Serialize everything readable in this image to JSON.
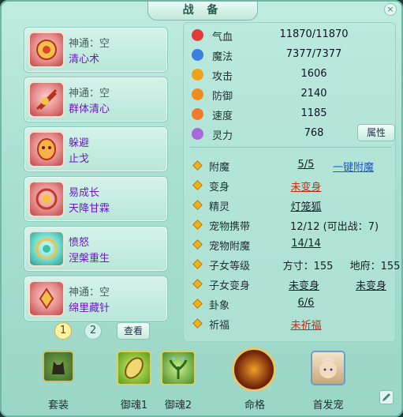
{
  "title": "战 备",
  "close_glyph": "×",
  "skills": [
    {
      "line1": "神通：空",
      "line2": "清心术",
      "icon": "skill-purify-icon"
    },
    {
      "line1": "神通：空",
      "line2": "群体清心",
      "icon": "skill-group-purify-icon"
    },
    {
      "line1": "躲避",
      "line2": "止戈",
      "icon": "skill-dodge-icon"
    },
    {
      "line1": "易成长",
      "line2": "天降甘霖",
      "icon": "skill-growth-icon"
    },
    {
      "line1": "愤怒",
      "line2": "涅槃重生",
      "icon": "skill-rage-icon"
    },
    {
      "line1": "神通：空",
      "line2": "绵里藏针",
      "icon": "skill-needle-icon"
    }
  ],
  "pager": {
    "page1": "1",
    "page2": "2",
    "view": "查看"
  },
  "stats": [
    {
      "label": "气血",
      "value": "11870/11870",
      "color": "#e23b3b"
    },
    {
      "label": "魔法",
      "value": "7377/7377",
      "color": "#3b7fe0"
    },
    {
      "label": "攻击",
      "value": "1606",
      "color": "#f0a11b"
    },
    {
      "label": "防御",
      "value": "2140",
      "color": "#f08c1b"
    },
    {
      "label": "速度",
      "value": "1185",
      "color": "#f27a2a"
    },
    {
      "label": "灵力",
      "value": "768",
      "color": "#a86ad8"
    }
  ],
  "attr_button": "属性",
  "details": {
    "enchant": {
      "label": "附魔",
      "value": "5/5",
      "link": "一键附魔"
    },
    "transform": {
      "label": "变身",
      "value": "未变身"
    },
    "spirit": {
      "label": "精灵",
      "value": "灯笼狐"
    },
    "pet_carry": {
      "label": "宠物携带",
      "value": "12/12 (可出战：7)"
    },
    "pet_enchant": {
      "label": "宠物附魔",
      "value": "14/14"
    },
    "child_level": {
      "label": "子女等级",
      "v1": "方寸：155",
      "v2": "地府：155"
    },
    "child_transform": {
      "label": "子女变身",
      "v1": "未变身",
      "v2": "未变身"
    },
    "hexagram": {
      "label": "卦象",
      "value": "6/6"
    },
    "blessing": {
      "label": "祈福",
      "value": "未祈福"
    }
  },
  "bottom": {
    "suit": "套装",
    "soul1": "御魂1",
    "soul2": "御魂2",
    "fate": "命格",
    "lead_pet": "首发宠"
  }
}
